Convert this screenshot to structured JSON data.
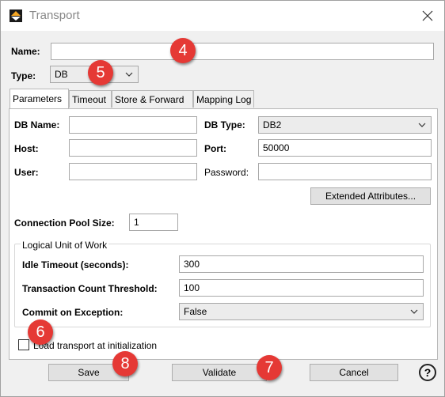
{
  "window": {
    "title": "Transport"
  },
  "form": {
    "name_label": "Name:",
    "name_value": "",
    "type_label": "Type:",
    "type_value": "DB"
  },
  "tabs": [
    {
      "label": "Parameters",
      "active": true
    },
    {
      "label": "Timeout"
    },
    {
      "label": "Store & Forward"
    },
    {
      "label": "Mapping Log"
    }
  ],
  "params": {
    "db_name_label": "DB Name:",
    "db_name_value": "",
    "db_type_label": "DB Type:",
    "db_type_value": "DB2",
    "host_label": "Host:",
    "host_value": "",
    "port_label": "Port:",
    "port_value": "50000",
    "user_label": "User:",
    "user_value": "",
    "password_label": "Password:",
    "password_value": "",
    "extended_button": "Extended Attributes...",
    "pool_label": "Connection Pool Size:",
    "pool_value": "1"
  },
  "luw": {
    "legend": "Logical Unit of Work",
    "idle_label": "Idle Timeout (seconds):",
    "idle_value": "300",
    "txn_label": "Transaction Count Threshold:",
    "txn_value": "100",
    "commit_label": "Commit on Exception:",
    "commit_value": "False"
  },
  "load_transport": {
    "label": "Load transport at initialization",
    "checked": false
  },
  "buttons": {
    "save": "Save",
    "validate": "Validate",
    "cancel": "Cancel",
    "help": "?"
  },
  "annotations": [
    "4",
    "5",
    "6",
    "7",
    "8"
  ],
  "colors": {
    "badge": "#e53935",
    "accent_orange": "#f5a623"
  }
}
